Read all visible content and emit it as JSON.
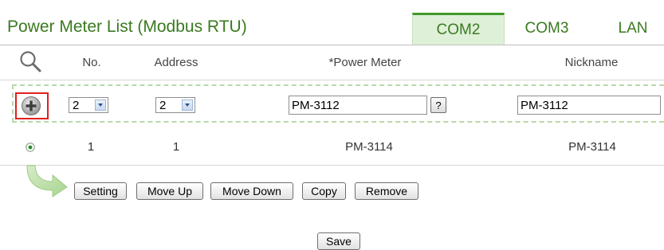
{
  "header": {
    "title": "Power Meter List (Modbus RTU)",
    "tabs": [
      {
        "label": "COM2",
        "active": true
      },
      {
        "label": "COM3",
        "active": false
      },
      {
        "label": "LAN",
        "active": false
      }
    ]
  },
  "table": {
    "columns": {
      "no": "No.",
      "address": "Address",
      "power_meter": "*Power Meter",
      "nickname": "Nickname"
    },
    "add_row": {
      "no_value": "2",
      "address_value": "2",
      "power_meter_value": "PM-3112",
      "help_label": "?",
      "nickname_value": "PM-3112"
    },
    "rows": [
      {
        "no": "1",
        "address": "1",
        "power_meter": "PM-3114",
        "nickname": "PM-3114",
        "selected": true
      }
    ]
  },
  "actions": {
    "setting": "Setting",
    "move_up": "Move Up",
    "move_down": "Move Down",
    "copy": "Copy",
    "remove": "Remove",
    "save": "Save"
  },
  "icons": {
    "search": "search-icon",
    "add": "add-circle-icon",
    "arrow": "green-curved-arrow-icon"
  },
  "colors": {
    "accent": "#3a7a20",
    "tab_active_bg": "#dff0d8",
    "dashed_border": "#b7d9a7",
    "highlight": "#e02020"
  }
}
